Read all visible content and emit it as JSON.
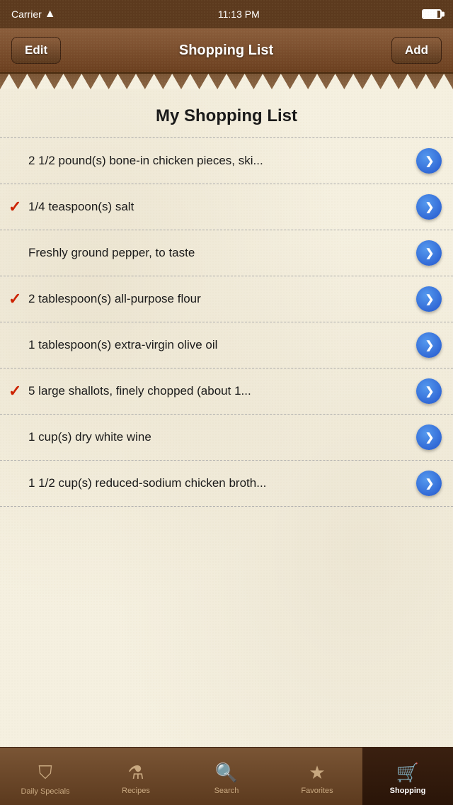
{
  "statusBar": {
    "carrier": "Carrier",
    "time": "11:13 PM"
  },
  "navBar": {
    "editLabel": "Edit",
    "title": "Shopping List",
    "addLabel": "Add"
  },
  "main": {
    "listTitle": "My Shopping List",
    "items": [
      {
        "id": 1,
        "text": "2 1/2 pound(s) bone-in chicken pieces, ski...",
        "checked": false
      },
      {
        "id": 2,
        "text": "1/4 teaspoon(s) salt",
        "checked": true
      },
      {
        "id": 3,
        "text": "Freshly ground pepper, to taste",
        "checked": false
      },
      {
        "id": 4,
        "text": "2 tablespoon(s) all-purpose flour",
        "checked": true
      },
      {
        "id": 5,
        "text": "1 tablespoon(s) extra-virgin olive oil",
        "checked": false
      },
      {
        "id": 6,
        "text": "5  large shallots, finely chopped (about 1...",
        "checked": true
      },
      {
        "id": 7,
        "text": "1 cup(s) dry white wine",
        "checked": false
      },
      {
        "id": 8,
        "text": "1 1/2 cup(s) reduced-sodium chicken broth...",
        "checked": false
      }
    ]
  },
  "tabBar": {
    "tabs": [
      {
        "id": "daily-specials",
        "label": "Daily Specials",
        "icon": "🛡",
        "active": false
      },
      {
        "id": "recipes",
        "label": "Recipes",
        "icon": "⚗",
        "active": false
      },
      {
        "id": "search",
        "label": "Search",
        "icon": "🔍",
        "active": false
      },
      {
        "id": "favorites",
        "label": "Favorites",
        "icon": "★",
        "active": false
      },
      {
        "id": "shopping",
        "label": "Shopping",
        "icon": "🛒",
        "active": true
      }
    ]
  }
}
